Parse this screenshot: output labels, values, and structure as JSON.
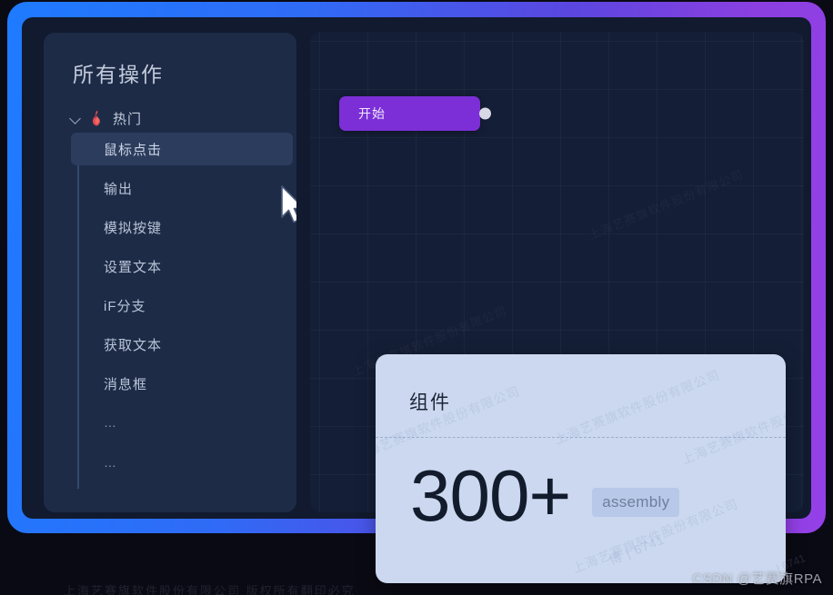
{
  "window": {
    "accent_gradient_start": "#1e7bff",
    "accent_gradient_end": "#9540e8",
    "background": "#0a0a14"
  },
  "sidebar": {
    "title": "所有操作",
    "group": {
      "chevron_icon": "chevron-down-icon",
      "badge_icon": "fire-icon",
      "label": "热门"
    },
    "items": [
      {
        "label": "鼠标点击",
        "active": true
      },
      {
        "label": "输出",
        "active": false
      },
      {
        "label": "模拟按键",
        "active": false
      },
      {
        "label": "设置文本",
        "active": false
      },
      {
        "label": "iF分支",
        "active": false
      },
      {
        "label": "获取文本",
        "active": false
      },
      {
        "label": "消息框",
        "active": false
      },
      {
        "label": "…",
        "active": false
      },
      {
        "label": "…",
        "active": false
      }
    ]
  },
  "canvas": {
    "cursor_icon": "mouse-pointer-icon",
    "nodes": [
      {
        "label": "开始",
        "color": "#7c2fd6",
        "port_icon": "output-port-icon"
      }
    ],
    "watermarks": [
      "上海艺赛旗软件股份有限公司",
      "上海艺赛旗软件股份有限公司",
      "上海艺赛旗软件股份有限公司"
    ]
  },
  "stat_card": {
    "title": "组件",
    "value": "300+",
    "badge": "assembly",
    "watermarks": [
      "上海艺赛旗软件股份有限公司",
      "上海艺赛旗软件股份有限公司",
      "上海艺赛旗软件股份有限公司",
      "上海艺赛旗软件股份有限公司"
    ],
    "corner_note": "博 | 6741"
  },
  "watermark": {
    "csdn": "CSDN @艺赛旗RPA",
    "csdn_sub": "| 6741",
    "bottom_strip": "上海艺赛旗软件股份有限公司  版权所有翻印必究"
  }
}
